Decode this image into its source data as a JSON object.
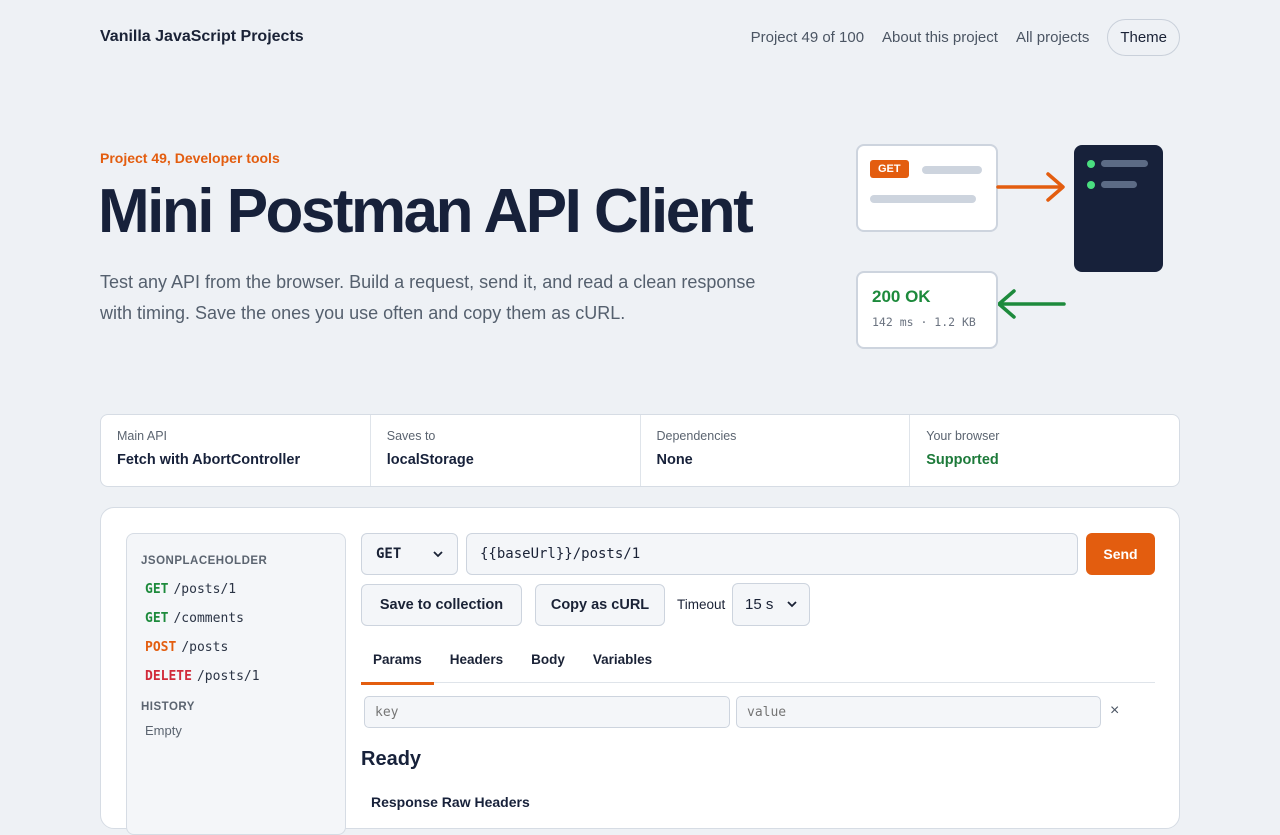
{
  "nav": {
    "brand": "Vanilla JavaScript Projects",
    "progress": "Project 49 of 100",
    "about": "About this project",
    "all": "All projects",
    "theme": "Theme"
  },
  "hero": {
    "eyebrow": "Project 49, Developer tools",
    "title": "Mini Postman API Client",
    "description": "Test any API from the browser. Build a request, send it, and read a clean response with timing. Save the ones you use often and copy them as cURL."
  },
  "illustration": {
    "method_tag": "GET",
    "status": "200 OK",
    "meta": "142 ms · 1.2 KB",
    "colors": {
      "accent": "#e35d0f",
      "success": "#1d8a3c",
      "server": "#17213a"
    }
  },
  "info": [
    {
      "label": "Main API",
      "value": "Fetch with AbortController"
    },
    {
      "label": "Saves to",
      "value": "localStorage"
    },
    {
      "label": "Dependencies",
      "value": "None"
    },
    {
      "label": "Your browser",
      "value": "Supported"
    }
  ],
  "sidebar": {
    "collection_title": "JSONPLACEHOLDER",
    "items": [
      {
        "method": "GET",
        "path": "/posts/1"
      },
      {
        "method": "GET",
        "path": "/comments"
      },
      {
        "method": "POST",
        "path": "/posts"
      },
      {
        "method": "DELETE",
        "path": "/posts/1"
      }
    ],
    "history_title": "HISTORY",
    "history_empty": "Empty"
  },
  "request": {
    "method": "GET",
    "url": "{{baseUrl}}/posts/1",
    "send": "Send",
    "save": "Save to collection",
    "copy": "Copy as cURL",
    "timeout_label": "Timeout",
    "timeout_value": "15 s"
  },
  "tabs": [
    "Params",
    "Headers",
    "Body",
    "Variables"
  ],
  "params": {
    "key_placeholder": "key",
    "value_placeholder": "value",
    "remove": "×"
  },
  "response": {
    "status": "Ready",
    "partial_text": "Response   Raw   Headers"
  }
}
